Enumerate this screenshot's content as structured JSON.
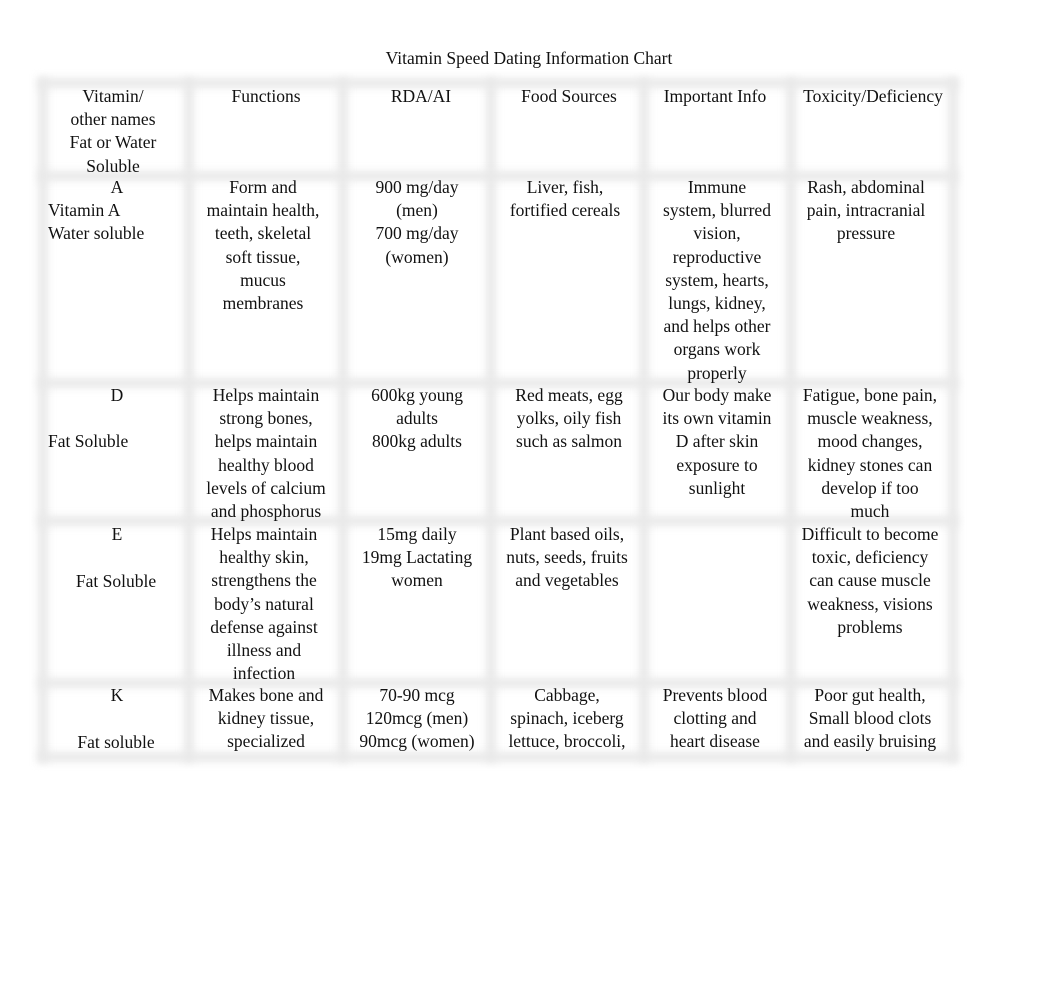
{
  "title": "Vitamin Speed Dating Information Chart",
  "headers": [
    "Vitamin/\nother names\nFat or Water\nSoluble",
    "Functions",
    "RDA/AI",
    "Food Sources",
    "Important Info",
    "Toxicity/Deficiency"
  ],
  "rows": [
    {
      "vitamin": "A",
      "other_names": "Vitamin A\nWater soluble",
      "functions": "Form and\nmaintain health,\nteeth, skeletal\nsoft tissue,\nmucus\nmembranes",
      "rda": "900 mg/day\n(men)\n700 mg/day\n(women)",
      "food_sources": "Liver, fish,\nfortified cereals",
      "important_info": "Immune\nsystem, blurred\nvision,\nreproductive\nsystem, hearts,\nlungs, kidney,\nand helps other\norgans work\nproperly",
      "toxicity": "Rash, abdominal\npain, intracranial\npressure"
    },
    {
      "vitamin": "D",
      "other_names": "Fat Soluble",
      "functions": "Helps maintain\nstrong bones,\nhelps maintain\nhealthy blood\nlevels of calcium\nand phosphorus",
      "rda": "600kg young\nadults\n800kg adults",
      "food_sources": "Red meats, egg\nyolks, oily fish\nsuch as salmon",
      "important_info": "Our body make\nits own vitamin\nD after skin\nexposure to\nsunlight",
      "toxicity": "Fatigue, bone pain,\nmuscle weakness,\nmood changes,\nkidney stones can\ndevelop if too\nmuch"
    },
    {
      "vitamin": "E",
      "other_names": "Fat Soluble",
      "functions": "Helps maintain\nhealthy skin,\nstrengthens the\nbody’s natural\ndefense against\nillness and\ninfection",
      "rda": "15mg daily\n19mg Lactating\nwomen",
      "food_sources": "Plant based oils,\nnuts, seeds, fruits\nand vegetables",
      "important_info": "",
      "toxicity": "Difficult to become\ntoxic, deficiency\ncan cause muscle\nweakness, visions\nproblems"
    },
    {
      "vitamin": "K",
      "other_names": "Fat soluble",
      "functions": "Makes bone and\nkidney tissue,\nspecialized",
      "rda": "70-90 mcg\n120mcg (men)\n90mcg (women)",
      "food_sources": "Cabbage,\nspinach, iceberg\nlettuce, broccoli,",
      "important_info": "Prevents blood\nclotting and\nheart disease",
      "toxicity": "Poor gut health,\nSmall blood clots\nand easily bruising"
    }
  ]
}
